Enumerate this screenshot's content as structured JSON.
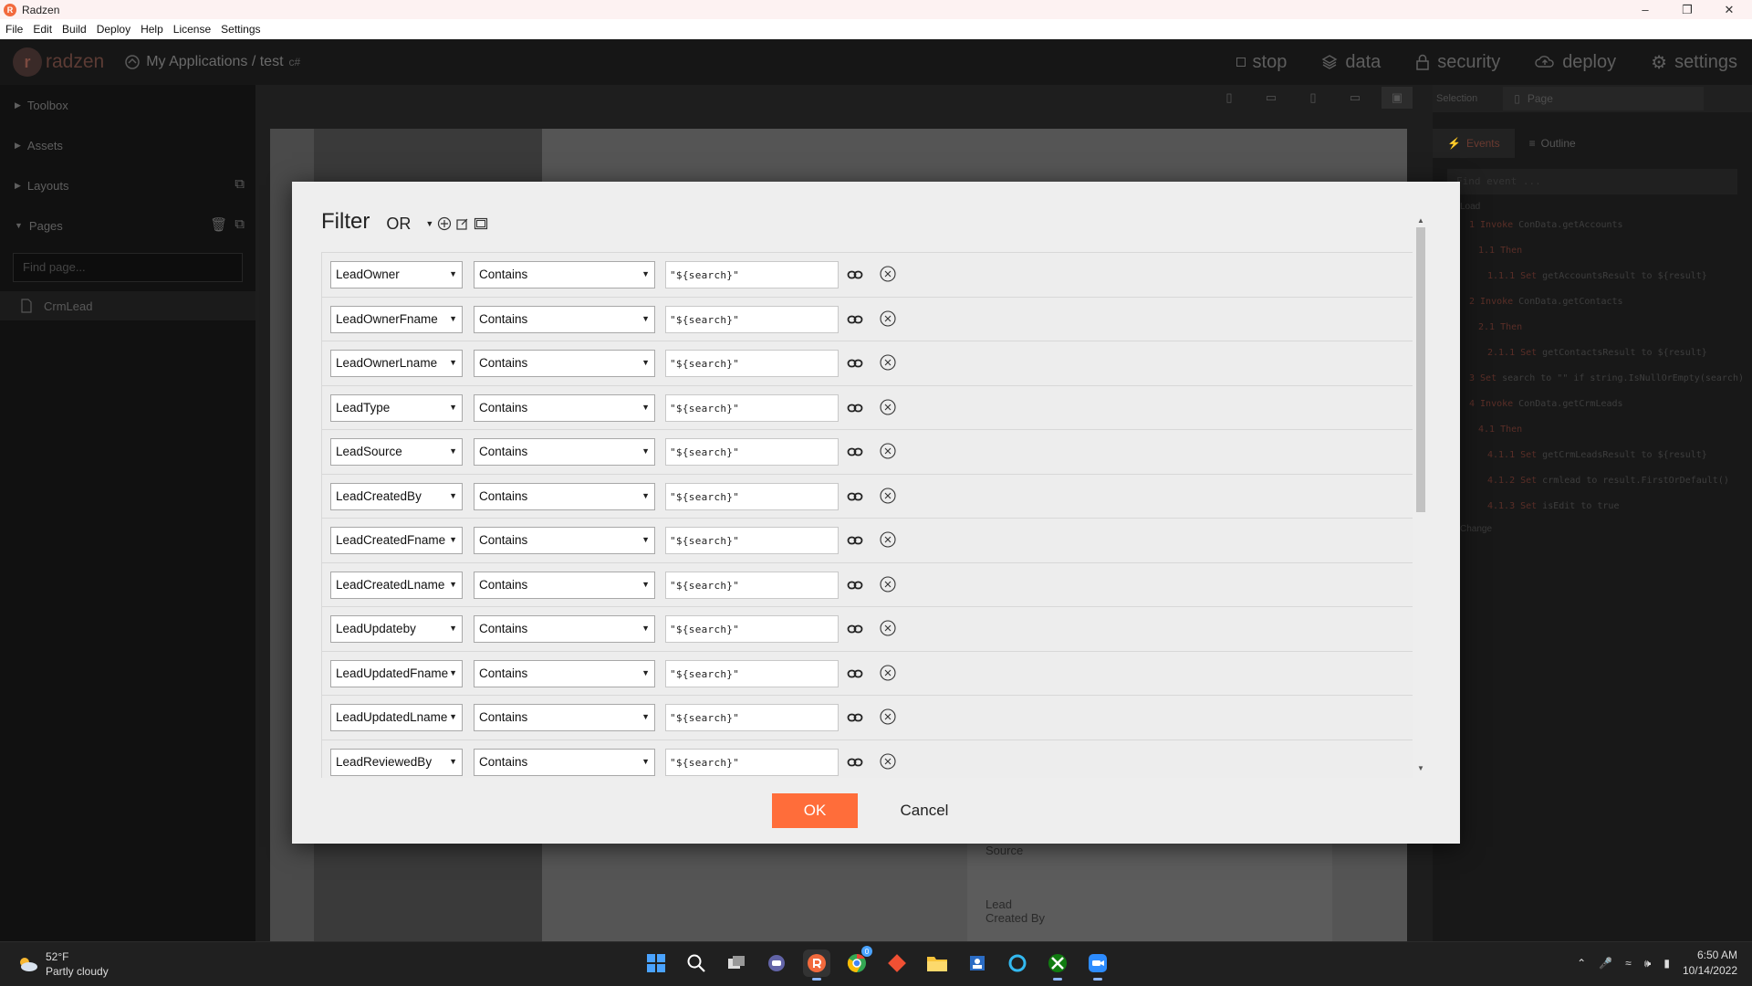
{
  "window": {
    "title": "Radzen",
    "app_icon_letter": "R"
  },
  "menu": [
    "File",
    "Edit",
    "Build",
    "Deploy",
    "Help",
    "License",
    "Settings"
  ],
  "header": {
    "logo_text": "radzen",
    "breadcrumb": "My Applications / test",
    "breadcrumb_tag": "c#",
    "nav": [
      {
        "label": "stop",
        "icon": "stop-icon"
      },
      {
        "label": "data",
        "icon": "layers-icon"
      },
      {
        "label": "security",
        "icon": "lock-icon"
      },
      {
        "label": "deploy",
        "icon": "cloud-upload-icon"
      },
      {
        "label": "settings",
        "icon": "gear-icon"
      }
    ]
  },
  "sidebar": {
    "sections": [
      "Toolbox",
      "Assets",
      "Layouts",
      "Pages"
    ],
    "find_placeholder": "Find page...",
    "pages": [
      "CrmLead"
    ]
  },
  "right_panel": {
    "selection_label": "Selection",
    "selection_value": "Page",
    "tabs": [
      "Events",
      "Outline"
    ],
    "find_placeholder": "Find event ...",
    "load_label": "Load",
    "change_label": "Change",
    "events": [
      {
        "num": "1",
        "kind": "Invoke",
        "text": "ConData.getAccounts"
      },
      {
        "num": "1.1",
        "kind": "Then",
        "text": ""
      },
      {
        "num": "1.1.1",
        "kind": "Set",
        "text": "getAccountsResult to ${result}"
      },
      {
        "num": "2",
        "kind": "Invoke",
        "text": "ConData.getContacts"
      },
      {
        "num": "2.1",
        "kind": "Then",
        "text": ""
      },
      {
        "num": "2.1.1",
        "kind": "Set",
        "text": "getContactsResult to ${result}"
      },
      {
        "num": "3",
        "kind": "Set",
        "text": "search to \"\" if string.IsNullOrEmpty(search)"
      },
      {
        "num": "4",
        "kind": "Invoke",
        "text": "ConData.getCrmLeads"
      },
      {
        "num": "4.1",
        "kind": "Then",
        "text": ""
      },
      {
        "num": "4.1.1",
        "kind": "Set",
        "text": "getCrmLeadsResult to ${result}"
      },
      {
        "num": "4.1.2",
        "kind": "Set",
        "text": "crmlead to result.FirstOrDefault()"
      },
      {
        "num": "4.1.3",
        "kind": "Set",
        "text": "isEdit to true"
      }
    ]
  },
  "canvas": {
    "label_source": "Source",
    "label_lead_created_by": "Lead\nCreated By"
  },
  "dialog": {
    "title": "Filter",
    "logical_operator": "OR",
    "rows": [
      {
        "field": "LeadOwner",
        "operator": "Contains",
        "value": "\"${search}\""
      },
      {
        "field": "LeadOwnerFname",
        "operator": "Contains",
        "value": "\"${search}\""
      },
      {
        "field": "LeadOwnerLname",
        "operator": "Contains",
        "value": "\"${search}\""
      },
      {
        "field": "LeadType",
        "operator": "Contains",
        "value": "\"${search}\""
      },
      {
        "field": "LeadSource",
        "operator": "Contains",
        "value": "\"${search}\""
      },
      {
        "field": "LeadCreatedBy",
        "operator": "Contains",
        "value": "\"${search}\""
      },
      {
        "field": "LeadCreatedFname",
        "operator": "Contains",
        "value": "\"${search}\""
      },
      {
        "field": "LeadCreatedLname",
        "operator": "Contains",
        "value": "\"${search}\""
      },
      {
        "field": "LeadUpdateby",
        "operator": "Contains",
        "value": "\"${search}\""
      },
      {
        "field": "LeadUpdatedFname",
        "operator": "Contains",
        "value": "\"${search}\""
      },
      {
        "field": "LeadUpdatedLname",
        "operator": "Contains",
        "value": "\"${search}\""
      },
      {
        "field": "LeadReviewedBy",
        "operator": "Contains",
        "value": "\"${search}\""
      }
    ],
    "ok_label": "OK",
    "cancel_label": "Cancel",
    "accent": "#ff6d3a"
  },
  "taskbar": {
    "weather_temp": "52°F",
    "weather_desc": "Partly cloudy",
    "time": "6:50 AM",
    "date": "10/14/2022",
    "apps": [
      "windows-start-icon",
      "search-icon",
      "task-view-icon",
      "teams-chat-icon",
      "radzen-app-icon",
      "chrome-icon",
      "git-icon",
      "file-explorer-icon",
      "people-icon",
      "cortana-icon",
      "xbox-icon",
      "zoom-icon"
    ],
    "chrome_badge": "0"
  }
}
